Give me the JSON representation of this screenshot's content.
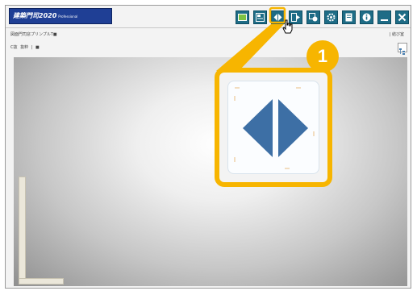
{
  "window": {
    "app_title": "建築門司2020",
    "edition": "Professional"
  },
  "toolbar": {
    "buttons": [
      {
        "id": "display-toggle",
        "icon": "rectangle-icon"
      },
      {
        "id": "screen",
        "icon": "window-icon"
      },
      {
        "id": "split-view",
        "icon": "split-arrows-icon"
      },
      {
        "id": "output",
        "icon": "export-icon"
      },
      {
        "id": "tools",
        "icon": "tools-icon"
      },
      {
        "id": "settings",
        "icon": "gear-icon"
      },
      {
        "id": "help",
        "icon": "book-icon"
      },
      {
        "id": "info",
        "icon": "info-icon"
      },
      {
        "id": "minimize",
        "icon": "minimize-icon"
      },
      {
        "id": "close",
        "icon": "close-icon"
      }
    ]
  },
  "subheader": {
    "left": "図面門司窓プリンプルT■",
    "right": "| 結び室"
  },
  "view_tabs": [
    "C抜",
    "抜粋",
    "|",
    "■"
  ],
  "callout": {
    "number": "1"
  },
  "colors": {
    "accent": "#f7b500",
    "toolbar_button": "#1e6c86",
    "logo_bg": "#1f3f95",
    "split_icon": "#3d6fa5"
  }
}
